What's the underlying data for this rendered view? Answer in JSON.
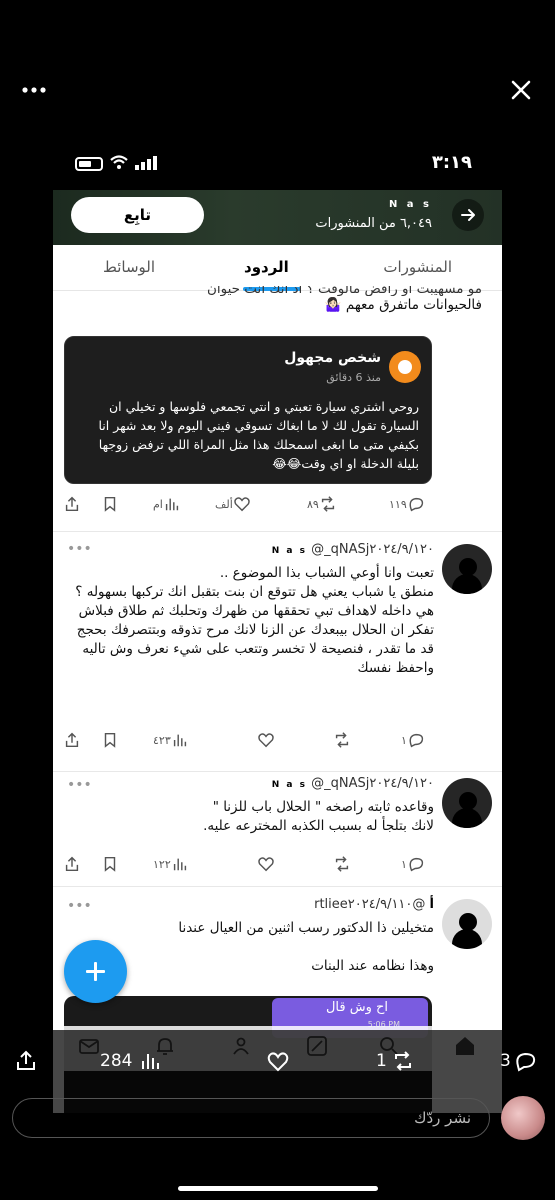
{
  "status": {
    "time": "٣:١٩"
  },
  "profile": {
    "name": "N a s",
    "posts_count": "٦,٠٤٩ من المنشورات",
    "follow_label": "تابِع"
  },
  "tabs": [
    {
      "label": "المنشورات"
    },
    {
      "label": "الردود"
    },
    {
      "label": "الوسائط"
    }
  ],
  "quoted": {
    "cut_line": "مو مسهيبت او رافض مالوفت ؟ اذ انك انت حيوان",
    "line": "فالحيوانات ماتفرق معهم 🤷🏻‍♀️",
    "card": {
      "name": "شخص مجهول",
      "time": "منذ 6 دقائق",
      "body": "روحي اشتري سيارة تعبتي و انتي تجمعي فلوسها و تخيلي ان السيارة تقول لك لا ما ابغاك تسوقي فيني اليوم ولا بعد شهر انا بكيفي متى ما ابغى اسمحلك هذا مثل المراة اللي ترفض زوجها بليلة الدخلة او اي وقت😂😂"
    },
    "stats": {
      "replies": "١١٩",
      "reposts": "٨٩",
      "likes": "ألف",
      "views": "ام"
    }
  },
  "replies": [
    {
      "name": "N a s",
      "handle_date": "@_qNASj٢٠٢٤/٩/١٢٠",
      "body": "تعبت وانا أوعي الشباب بذا الموضوع ..\nمنطق يا شباب يعني هل تتوقع ان بنت بتقبل انك تركبها بسهوله ؟ هي داخله لاهداف تبي تحققها من ظهرك وتحلبك ثم طلاق فبلاش تفكر ان الحلال بيبعدك عن الزنا لانك مرح تذوقه وبتتصرفك بحجج قد ما تقدر ، فنصيحة لا تخسر وتتعب على شيء نعرف وش تاليه واحفظ نفسك",
      "stats": {
        "replies": "١",
        "reposts": "",
        "likes": "",
        "views": "٤٢٣"
      }
    },
    {
      "name": "N a s",
      "handle_date": "@_qNASj٢٠٢٤/٩/١٢٠",
      "body": "وقاعده ثابته راصخه \" الحلال باب للزنا \"\nلانك بتلجأ له بسبب الكذبه المخترعه عليه.",
      "stats": {
        "replies": "١",
        "reposts": "",
        "likes": "",
        "views": "١٢٢"
      }
    },
    {
      "name": "أ",
      "handle_date": "@rtliee٢٠٢٤/٩/١١٠",
      "body": "متخيلين ذا الدكتور رسب اثنين من العيال عندنا\n\nوهذا نظامه عند البنات",
      "image": {
        "bubble_text": "اح وش قال",
        "bubble_time": "5:06 PM"
      }
    }
  ],
  "viewer": {
    "likes": "3",
    "reposts": "1",
    "views": "284",
    "reply_placeholder": "نشر ردّك"
  },
  "colors": {
    "accent": "#1d9bf0",
    "card_bg": "#1e1e1e",
    "bubble": "#7a5ce0"
  }
}
